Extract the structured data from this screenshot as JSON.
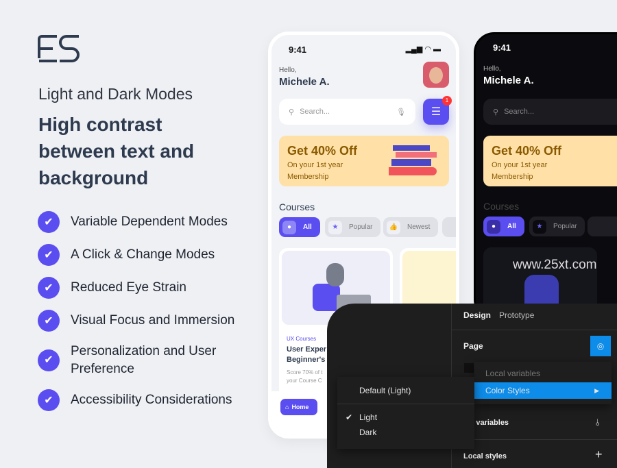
{
  "hero": {
    "logo_text": "ES",
    "subtitle": "Light and Dark Modes",
    "heading": "High contrast between text and background",
    "features": [
      "Variable Dependent Modes",
      "A Click & Change Modes",
      "Reduced Eye Strain",
      "Visual Focus and Immersion",
      "Personalization and User Preference",
      "Accessibility Considerations"
    ]
  },
  "phone": {
    "time": "9:41",
    "greeting": "Hello,",
    "name": "Michele A.",
    "search_placeholder": "Search...",
    "filter_badge": "1",
    "promo": {
      "title": "Get 40% Off",
      "line1": "On your 1st year",
      "line2": "Membership"
    },
    "courses_title": "Courses",
    "chips": [
      "All",
      "Popular",
      "Newest"
    ],
    "card": {
      "category": "UX Courses",
      "title1": "User Exper",
      "title2": "Beginner's",
      "desc1": "Score 70% of t",
      "desc2": "your Course C"
    },
    "nav_home": "Home"
  },
  "watermark": "www.25xt.com",
  "figma": {
    "tabs": [
      "Design",
      "Prototype"
    ],
    "page_label": "Page",
    "local_variables_dim": "Local variables",
    "color_styles": "Color Styles",
    "mode_default": "Default (Light)",
    "modes": [
      "Light",
      "Dark"
    ],
    "selected_mode": "Light",
    "local_variables": "cal variables",
    "local_styles": "Local styles"
  },
  "colors": {
    "accent": "#5b4ef0",
    "figma_blue": "#0d8ce9",
    "promo": "#ffe1a8"
  }
}
